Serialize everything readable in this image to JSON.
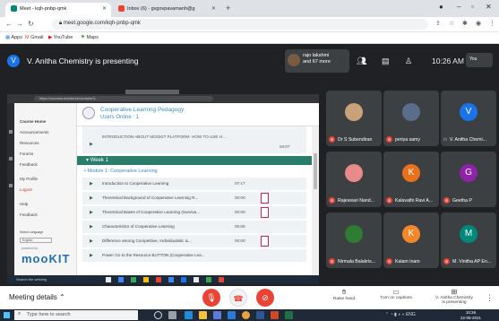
{
  "browser": {
    "tabs": [
      {
        "label": "Meet - kqh-pnbp-qmk",
        "active": true
      },
      {
        "label": "Inbox (6) - gvgovpavamanh@g",
        "active": false
      }
    ],
    "url": "meet.google.com/kqh-pnbp-qmk",
    "bookmarks": [
      "Apps",
      "Gmail",
      "YouTube",
      "Maps"
    ]
  },
  "meet": {
    "presenter_initial": "V",
    "presenter_text": "V. Anitha Chemistry is presenting",
    "floating_participant": {
      "name": "rajo lakshmi",
      "extra": "and 67 more"
    },
    "clock": "10:26 AM",
    "self_label": "You"
  },
  "shared_screen": {
    "lms_title": "Cooperative Learning Pedagogy",
    "lms_subtitle": "Users Online : 1",
    "sidebar_items": [
      {
        "label": "Course Home",
        "red": false
      },
      {
        "label": "Announcements",
        "red": false
      },
      {
        "label": "Resources",
        "red": false
      },
      {
        "label": "Forums",
        "red": false
      },
      {
        "label": "Feedback",
        "red": false
      },
      {
        "label": "My Profile",
        "red": false
      },
      {
        "label": "Logout",
        "red": true
      },
      {
        "label": "Help",
        "red": false
      },
      {
        "label": "Feedback",
        "red": false
      }
    ],
    "language_label": "Select Language",
    "language_value": "English",
    "powered_by": "powered by",
    "brand": "mooKIT",
    "intro_title": "INTRODUCTION ABOUT MOOKIT PLATFORM- HOW TO USE H...",
    "intro_duration": "04:07",
    "week_label": "Week 1",
    "module_label": "Module 1: Cooperative Learning",
    "lessons": [
      {
        "title": "Introduction to Cooperative Learning",
        "duration": "07:17",
        "doc": false
      },
      {
        "title": "Theoretical Background of Cooperative Learning R...",
        "duration": "00:00",
        "doc": true
      },
      {
        "title": "Theoretical Bases of Cooperative Learning (Surviva...",
        "duration": "00:00",
        "doc": true
      },
      {
        "title": "Characteristics of Cooperative Learning",
        "duration": "05:55",
        "doc": false
      },
      {
        "title": "Difference among Competitive, Individualistic &...",
        "duration": "00:00",
        "doc": true
      },
      {
        "title": "Power Go to the Resource BUTTON (Cooperative Lea...",
        "duration": "",
        "doc": false
      }
    ],
    "search_text": "Search the web/ing"
  },
  "participants": [
    {
      "name": "Dr S Subendiran",
      "initial": "",
      "color": "#c9a27a",
      "muted": true
    },
    {
      "name": "periya samy",
      "initial": "",
      "color": "#5a6d8a",
      "muted": true
    },
    {
      "name": "V. Anitha Chemi...",
      "initial": "V",
      "color": "#1a73e8",
      "muted": false
    },
    {
      "name": "Rajeswari Nand...",
      "initial": "",
      "color": "#e88a8a",
      "muted": true
    },
    {
      "name": "Kalavathi Ravi A...",
      "initial": "K",
      "color": "#e8711a",
      "muted": true
    },
    {
      "name": "Geetha P",
      "initial": "G",
      "color": "#8e24aa",
      "muted": true
    },
    {
      "name": "Nirmala Balakris...",
      "initial": "",
      "color": "#2e7d32",
      "muted": true
    },
    {
      "name": "Kalam Inam",
      "initial": "K",
      "color": "#f4862b",
      "muted": true
    },
    {
      "name": "M. Vinitha AP En...",
      "initial": "M",
      "color": "#00897b",
      "muted": true
    }
  ],
  "toolbar": {
    "meeting_details": "Meeting details",
    "raise_hand": "Raise hand",
    "captions": "Turn on captions",
    "presenting_line1": "V. Anitha Chemistry",
    "presenting_line2": "is presenting"
  },
  "taskbar": {
    "search_placeholder": "Type here to search",
    "time": "10:26",
    "date": "22-05-2021",
    "lang": "ENG"
  }
}
